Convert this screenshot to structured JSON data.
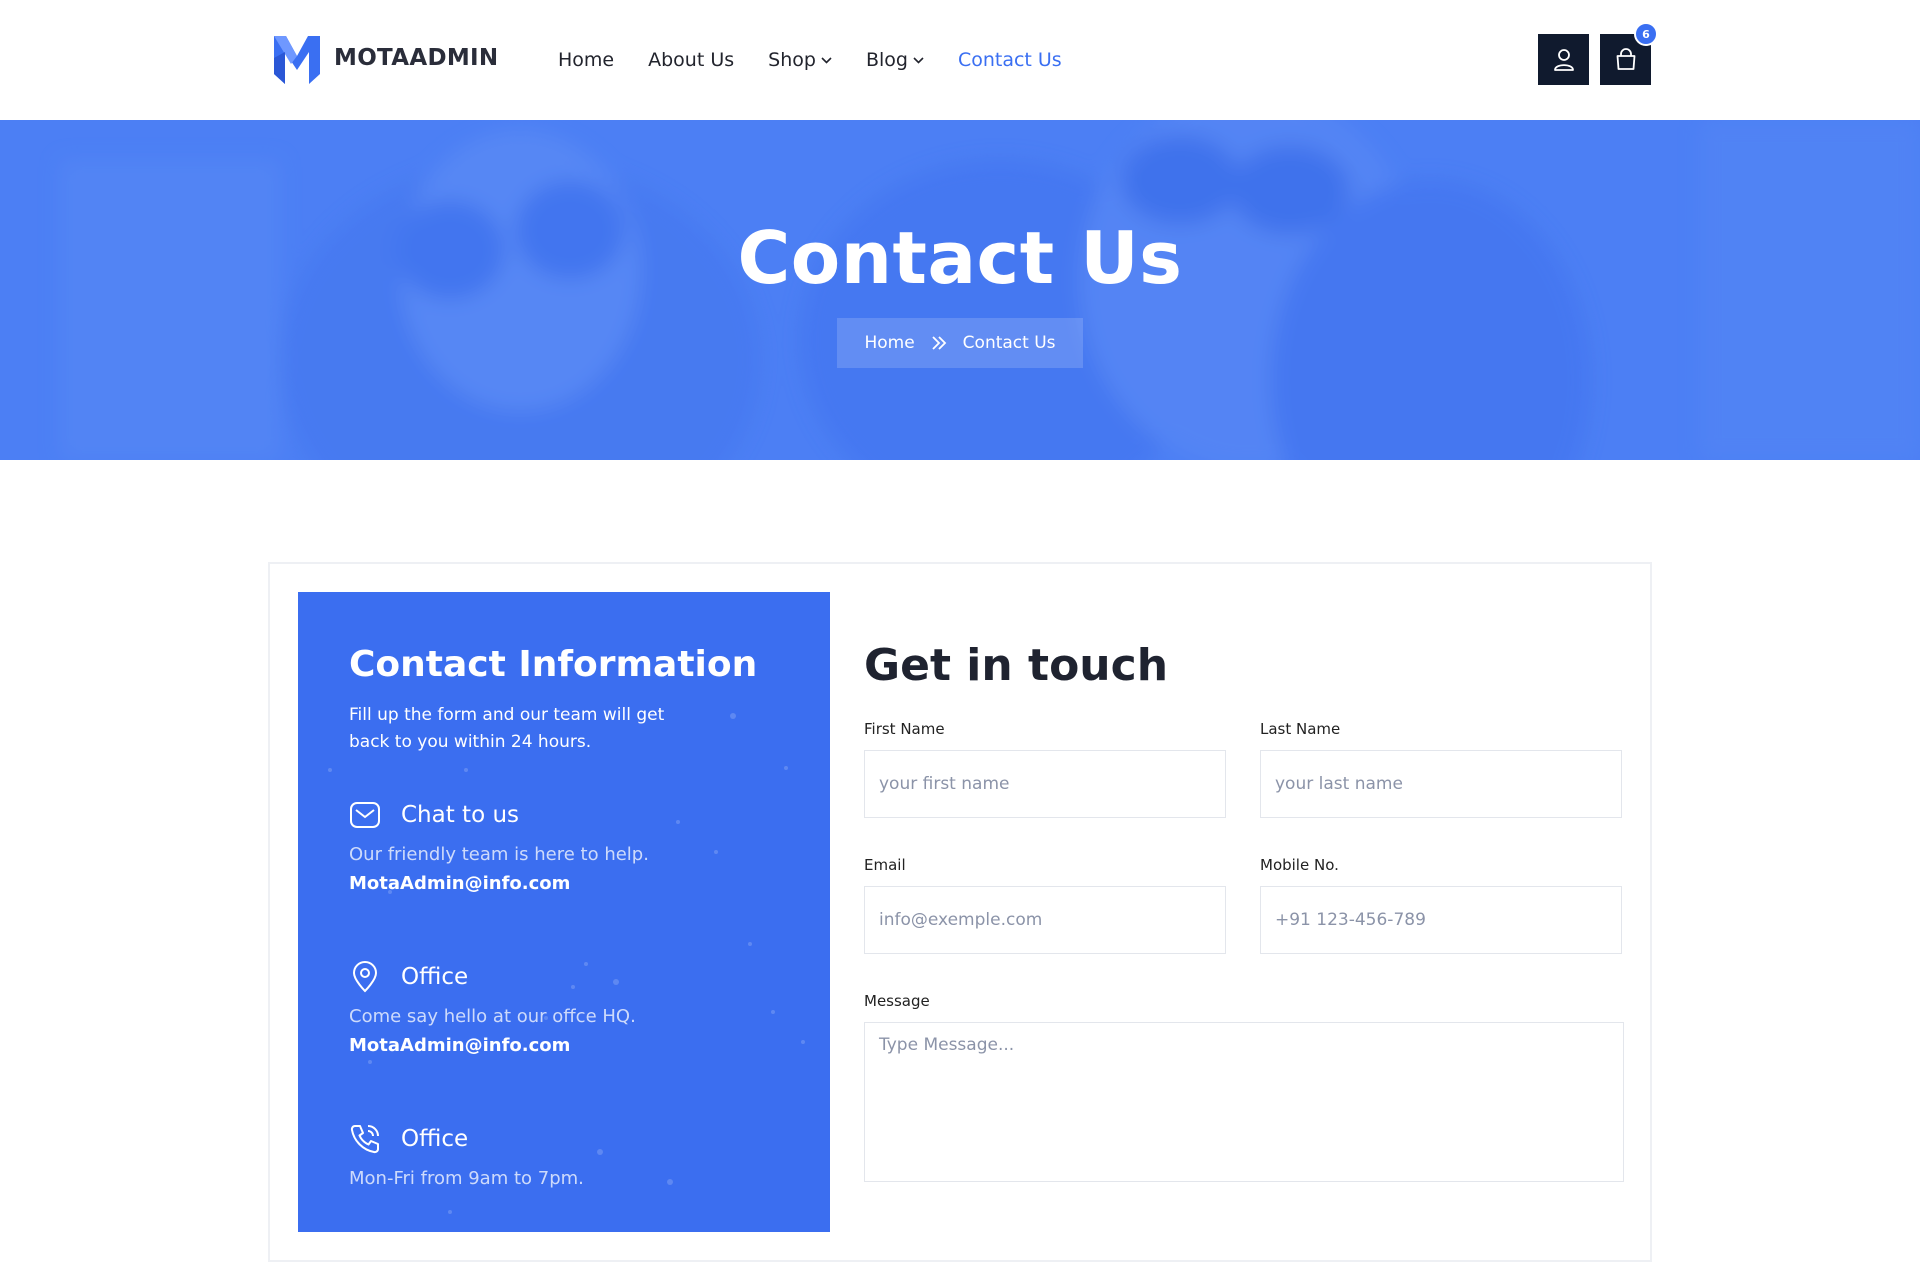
{
  "brand": {
    "name": "MOTAADMIN",
    "accent": "#3a6ff2",
    "dark": "#101a2e"
  },
  "nav": {
    "items": [
      {
        "label": "Home"
      },
      {
        "label": "About Us"
      },
      {
        "label": "Shop"
      },
      {
        "label": "Blog"
      },
      {
        "label": "Contact Us"
      }
    ],
    "active": "Contact Us"
  },
  "header_actions": {
    "user_icon": "user-icon",
    "cart_icon": "shopping-bag-icon",
    "cart_count": "6"
  },
  "hero": {
    "title": "Contact Us",
    "breadcrumb": {
      "home": "Home",
      "current": "Contact Us"
    }
  },
  "contact_info": {
    "title": "Contact Information",
    "intro": "Fill up the form and our team will get back to you within 24 hours.",
    "blocks": [
      {
        "icon": "mail-icon",
        "title": "Chat to us",
        "desc": "Our friendly team is here to help.",
        "link": "MotaAdmin@info.com"
      },
      {
        "icon": "map-pin-icon",
        "title": "Office",
        "desc": "Come say hello at our offce HQ.",
        "link": "MotaAdmin@info.com"
      },
      {
        "icon": "phone-icon",
        "title": "Office",
        "desc": "Mon-Fri from 9am to 7pm."
      }
    ]
  },
  "form": {
    "title": "Get in touch",
    "first_name": {
      "label": "First Name",
      "placeholder": "your first name",
      "value": ""
    },
    "last_name": {
      "label": "Last Name",
      "placeholder": "your last name",
      "value": ""
    },
    "email": {
      "label": "Email",
      "placeholder": "info@exemple.com",
      "value": ""
    },
    "mobile": {
      "label": "Mobile No.",
      "placeholder": "+91 123-456-789",
      "value": ""
    },
    "message": {
      "label": "Message",
      "placeholder": "Type Message...",
      "value": ""
    }
  }
}
